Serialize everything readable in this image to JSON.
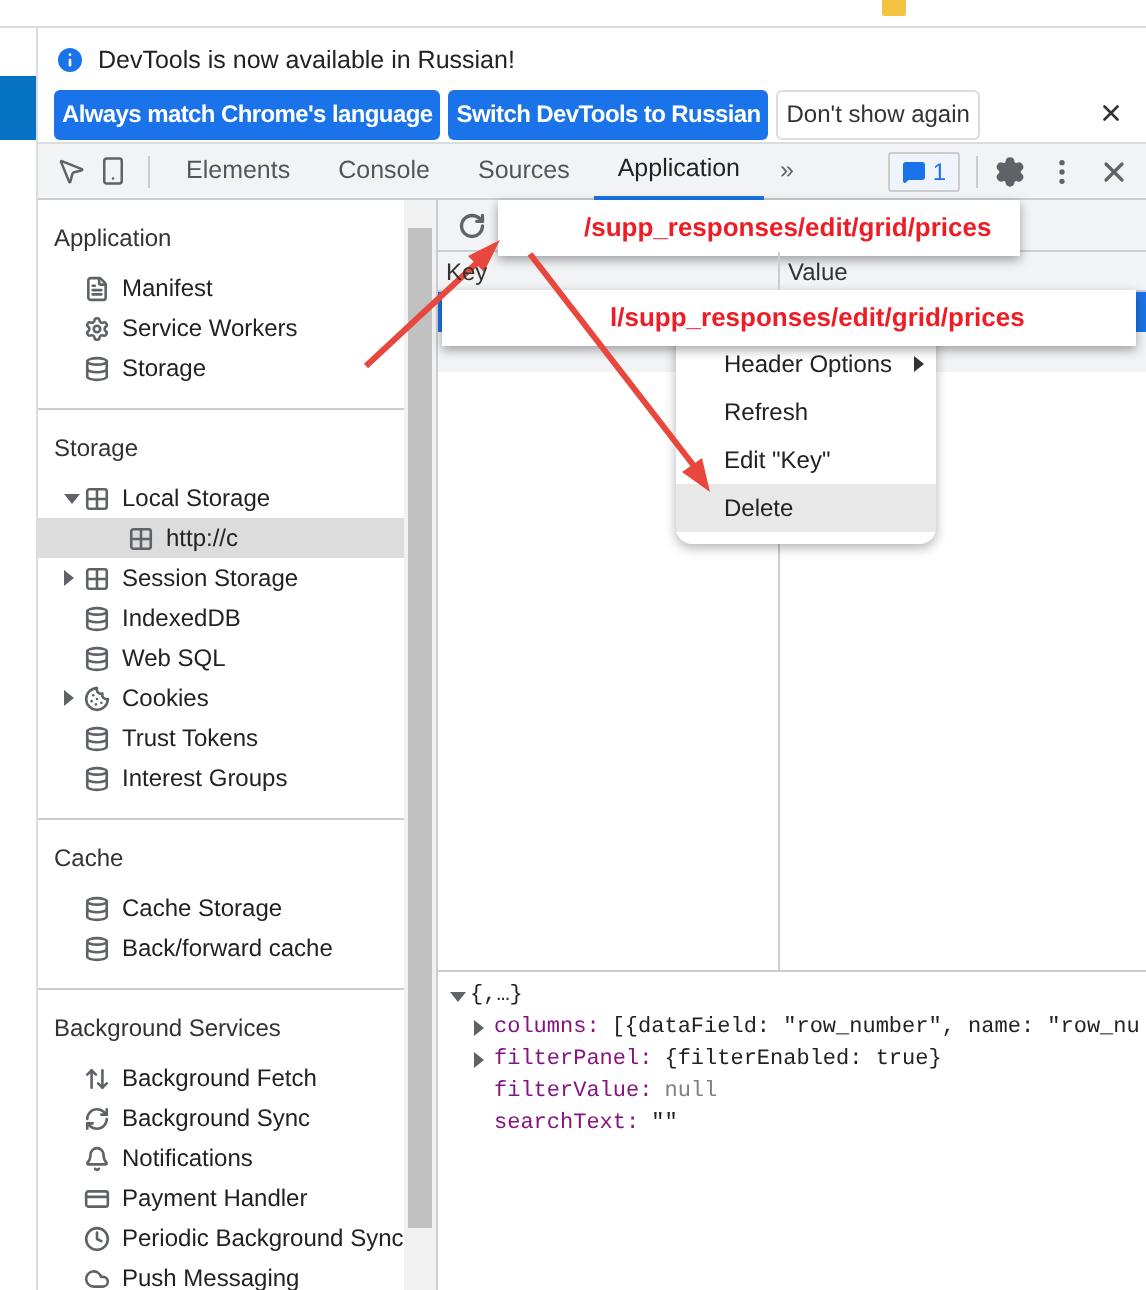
{
  "infobar": {
    "message": "DevTools is now available in Russian!",
    "buttons": [
      {
        "label": "Always match Chrome's language",
        "kind": "primary"
      },
      {
        "label": "Switch DevTools to Russian",
        "kind": "primary"
      },
      {
        "label": "Don't show again",
        "kind": "secondary"
      }
    ]
  },
  "tabs": [
    {
      "label": "Elements",
      "selected": false
    },
    {
      "label": "Console",
      "selected": false
    },
    {
      "label": "Sources",
      "selected": false
    },
    {
      "label": "Application",
      "selected": true
    }
  ],
  "more_tabs": "»",
  "issues_count": "1",
  "sidebar": {
    "sections": [
      {
        "title": "Application",
        "items": [
          {
            "label": "Manifest",
            "kind": "file"
          },
          {
            "label": "Service Workers",
            "kind": "gear"
          },
          {
            "label": "Storage",
            "kind": "database"
          }
        ]
      },
      {
        "title": "Storage",
        "items": [
          {
            "label": "Local Storage",
            "kind": "grid",
            "expanded": true,
            "children": [
              {
                "label": "http://c",
                "kind": "grid",
                "selected": true
              }
            ]
          },
          {
            "label": "Session Storage",
            "kind": "grid",
            "expanded": false
          },
          {
            "label": "IndexedDB",
            "kind": "database"
          },
          {
            "label": "Web SQL",
            "kind": "database"
          },
          {
            "label": "Cookies",
            "kind": "cookie",
            "expanded": false
          },
          {
            "label": "Trust Tokens",
            "kind": "database"
          },
          {
            "label": "Interest Groups",
            "kind": "database"
          }
        ]
      },
      {
        "title": "Cache",
        "items": [
          {
            "label": "Cache Storage",
            "kind": "database"
          },
          {
            "label": "Back/forward cache",
            "kind": "database"
          }
        ]
      },
      {
        "title": "Background Services",
        "items": [
          {
            "label": "Background Fetch",
            "kind": "updown"
          },
          {
            "label": "Background Sync",
            "kind": "sync"
          },
          {
            "label": "Notifications",
            "kind": "bell"
          },
          {
            "label": "Payment Handler",
            "kind": "card"
          },
          {
            "label": "Periodic Background Sync",
            "kind": "clock"
          },
          {
            "label": "Push Messaging",
            "kind": "cloud"
          }
        ]
      }
    ]
  },
  "grid": {
    "columns": [
      "Key",
      "Value"
    ],
    "rows": [
      {
        "selected": true
      }
    ]
  },
  "context_menu": {
    "items": [
      {
        "label": "Header Options",
        "has_submenu": true,
        "selected": false
      },
      {
        "label": "Refresh",
        "has_submenu": false,
        "selected": false
      },
      {
        "label": "Edit \"Key\"",
        "has_submenu": false,
        "selected": false
      },
      {
        "label": "Delete",
        "has_submenu": false,
        "selected": true
      }
    ]
  },
  "annotations": [
    {
      "text": "/supp_responses/edit/grid/prices"
    },
    {
      "text": "l/supp_responses/edit/grid/prices"
    }
  ],
  "preview": {
    "root": "{,…}",
    "expanded": true,
    "properties": [
      {
        "key": "columns:",
        "value": "[{dataField: \"row_number\", name: \"row_nu",
        "kind": "object",
        "expandable": true
      },
      {
        "key": "filterPanel:",
        "value": "{filterEnabled: true}",
        "kind": "object",
        "expandable": true
      },
      {
        "key": "filterValue:",
        "value": "null",
        "kind": "null",
        "expandable": false
      },
      {
        "key": "searchText:",
        "value": "\"\"",
        "kind": "string",
        "expandable": false
      }
    ]
  }
}
